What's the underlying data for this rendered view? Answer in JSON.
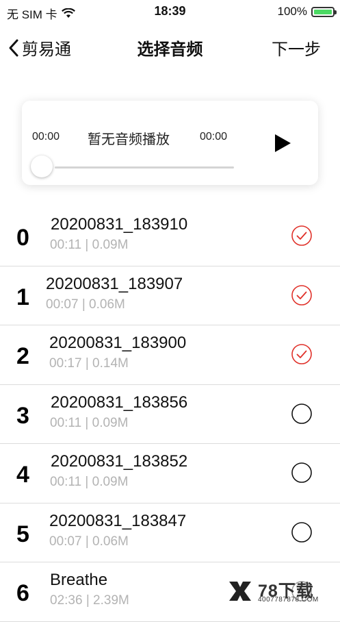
{
  "status_bar": {
    "carrier": "无 SIM 卡",
    "time": "18:39",
    "battery": "100%"
  },
  "nav": {
    "back_label": "剪易通",
    "title": "选择音频",
    "next_label": "下一步"
  },
  "player": {
    "current_time": "00:00",
    "status": "暂无音频播放",
    "total_time": "00:00",
    "progress": 0
  },
  "colors": {
    "accent_red": "#e0312a",
    "battery_green": "#4cd964",
    "meta_gray": "#b3b3b3"
  },
  "items": [
    {
      "index": "0",
      "name": "20200831_183910",
      "meta": "00:11 | 0.09M",
      "selected": true
    },
    {
      "index": "1",
      "name": "20200831_183907",
      "meta": "00:07 | 0.06M",
      "selected": true
    },
    {
      "index": "2",
      "name": "20200831_183900",
      "meta": "00:17 | 0.14M",
      "selected": true
    },
    {
      "index": "3",
      "name": "20200831_183856",
      "meta": "00:11 | 0.09M",
      "selected": false
    },
    {
      "index": "4",
      "name": "20200831_183852",
      "meta": "00:11 | 0.09M",
      "selected": false
    },
    {
      "index": "5",
      "name": "20200831_183847",
      "meta": "00:07 | 0.06M",
      "selected": false
    },
    {
      "index": "6",
      "name": "Breathe",
      "meta": "02:36 | 2.39M",
      "selected": false
    }
  ],
  "watermark": {
    "brand": "78下载",
    "url": "4007787878.COM"
  }
}
